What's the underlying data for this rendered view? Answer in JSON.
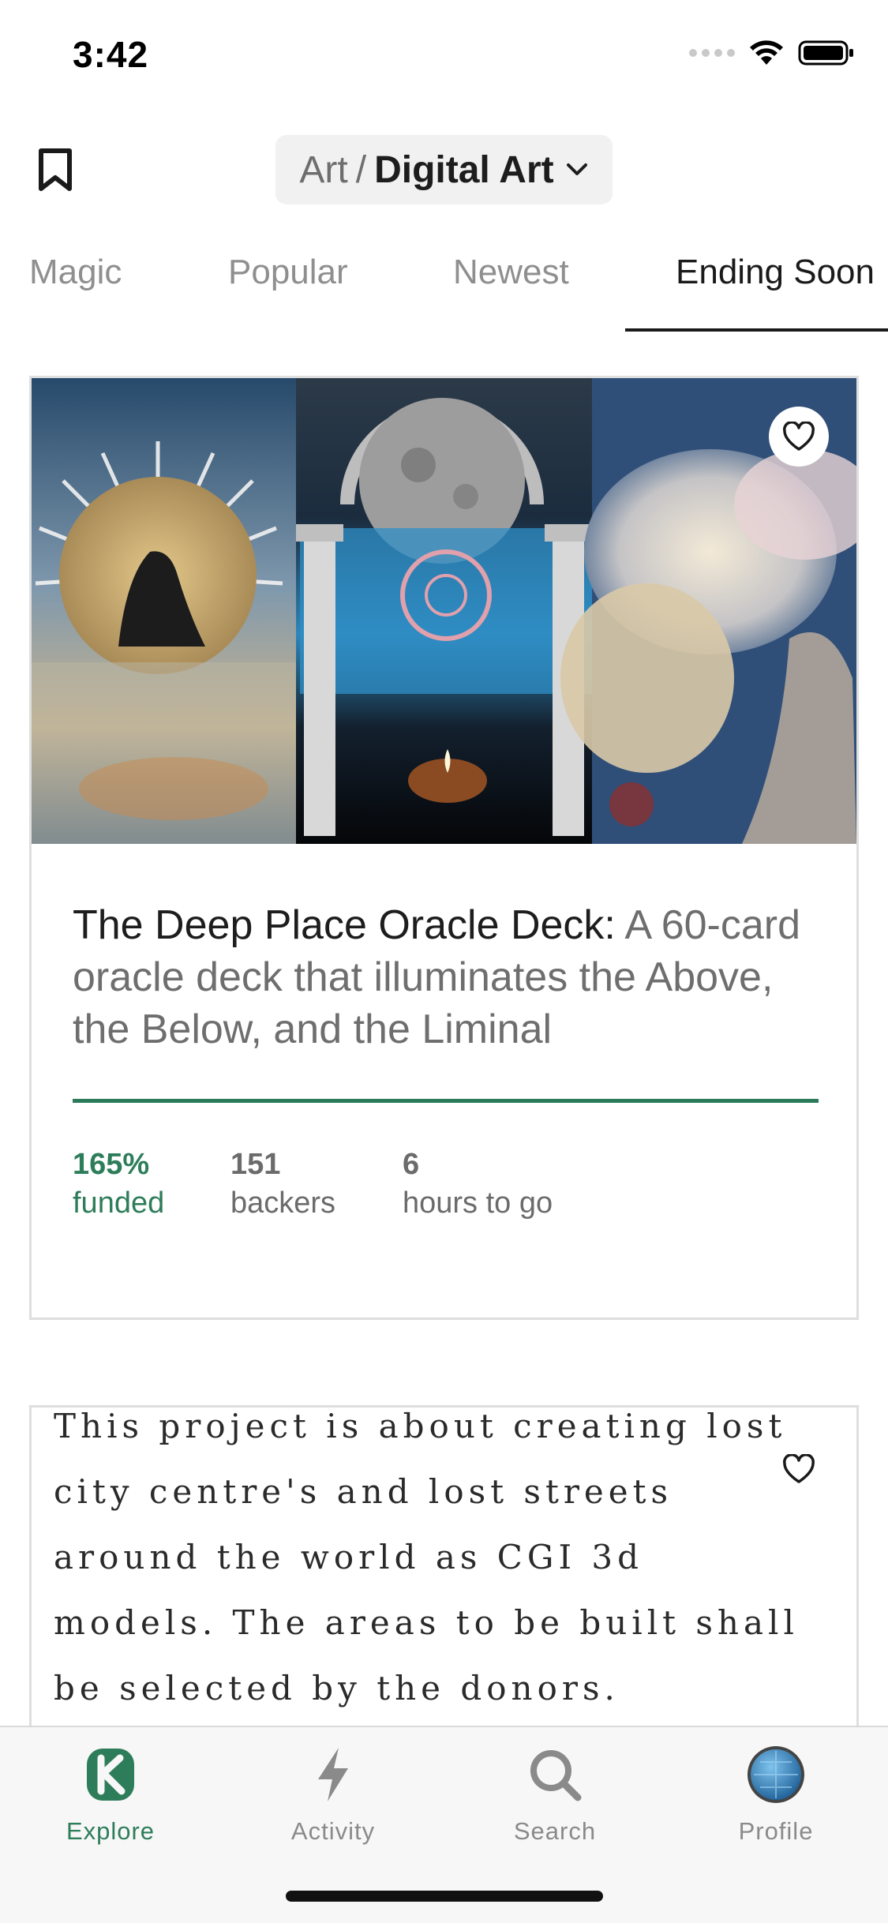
{
  "status_bar": {
    "time": "3:42",
    "icons": [
      "cellular-signal-icon",
      "wifi-icon",
      "battery-icon"
    ]
  },
  "header": {
    "bookmark_icon": "bookmark-icon",
    "category_parent": "Art",
    "category_separator": "/",
    "category_current": "Digital Art",
    "dropdown_icon": "chevron-down-icon"
  },
  "sort_tabs": [
    {
      "label": "Magic",
      "active": false
    },
    {
      "label": "Popular",
      "active": false
    },
    {
      "label": "Newest",
      "active": false
    },
    {
      "label": "Ending Soon",
      "active": true
    }
  ],
  "projects": [
    {
      "name": "The Deep Place Oracle Deck:",
      "blurb": "A 60-card oracle deck that illuminates the Above, the Below, and the Liminal",
      "funded_fraction": 1.65,
      "stats": {
        "funded_value": "165%",
        "funded_label": "funded",
        "backers_value": "151",
        "backers_label": "backers",
        "time_value": "6",
        "time_label": "hours to go"
      },
      "favorite_icon": "heart-outline-icon"
    },
    {
      "image_text": "This project is about creating lost city centre's and lost streets around the world as CGI 3d models. The areas to be built shall be selected by the donors.",
      "favorite_icon": "heart-outline-icon"
    }
  ],
  "tab_bar": [
    {
      "label": "Explore",
      "icon": "kickstarter-logo-icon",
      "active": true
    },
    {
      "label": "Activity",
      "icon": "lightning-bolt-icon",
      "active": false
    },
    {
      "label": "Search",
      "icon": "search-icon",
      "active": false
    },
    {
      "label": "Profile",
      "icon": "avatar-icon",
      "active": false
    }
  ],
  "colors": {
    "accent_green": "#2e7d5a",
    "tab_inactive": "#8f8f8f",
    "pill_background": "#f1f1f1"
  }
}
